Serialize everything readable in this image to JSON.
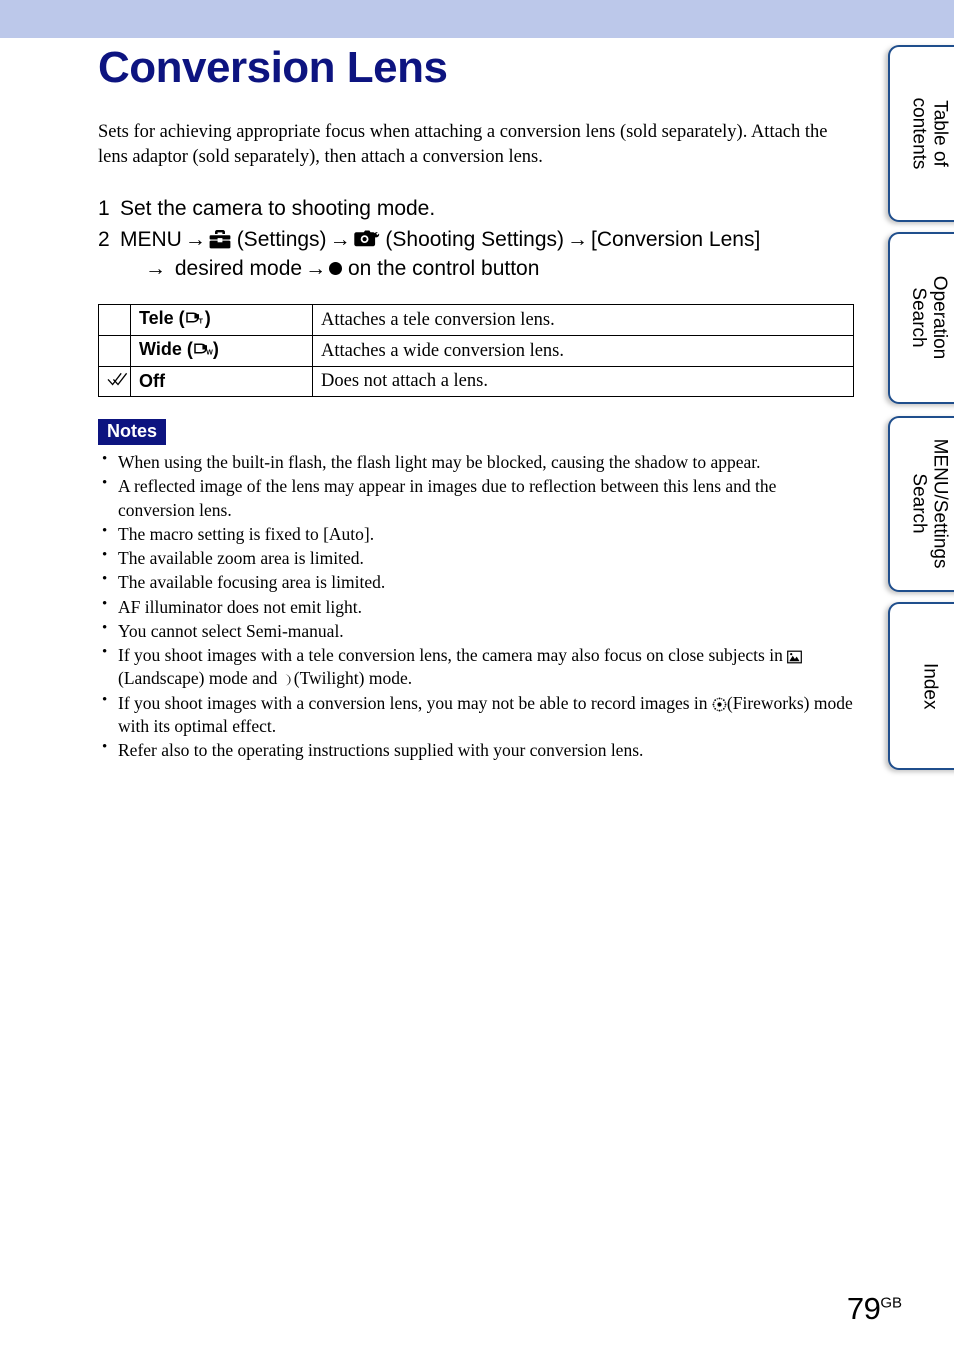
{
  "page": {
    "title": "Conversion Lens",
    "intro": "Sets for achieving appropriate focus when attaching a conversion lens (sold separately). Attach the lens adaptor (sold separately), then attach a conversion lens.",
    "number": "79",
    "number_suffix": "GB",
    "title_color": "#0d1480",
    "topbar_color": "#bcc8ea"
  },
  "tabs": [
    {
      "label": "Table of\ncontents",
      "name": "table-of-contents"
    },
    {
      "label": "Operation\nSearch",
      "name": "operation-search"
    },
    {
      "label": "MENU/Settings\nSearch",
      "name": "menu-settings-search"
    },
    {
      "label": "Index",
      "name": "index"
    }
  ],
  "steps": [
    {
      "number": "1",
      "text": "Set the camera to shooting mode."
    },
    {
      "number": "2",
      "parts": {
        "menu": "MENU",
        "arrow": "→",
        "settings_label": "(Settings)",
        "settings_icon": "toolbox-icon",
        "shooting_label": "(Shooting Settings)",
        "shooting_icon": "camera-wrench-icon",
        "item": "[Conversion Lens]",
        "desired": "desired mode",
        "control": "on the control button",
        "control_icon": "center-button-icon"
      }
    }
  ],
  "table": {
    "rows": [
      {
        "checked": false,
        "check_icon": "",
        "name": "Tele (",
        "name_suffix": ")",
        "icon": "lens-tele-icon",
        "icon_sub": "T",
        "desc": "Attaches a tele conversion lens."
      },
      {
        "checked": false,
        "check_icon": "",
        "name": "Wide (",
        "name_suffix": ")",
        "icon": "lens-wide-icon",
        "icon_sub": "W",
        "desc": "Attaches a wide conversion lens."
      },
      {
        "checked": true,
        "check_icon": "double-check-icon",
        "name": "Off",
        "name_suffix": "",
        "icon": "",
        "icon_sub": "",
        "desc": "Does not attach a lens."
      }
    ]
  },
  "notes": {
    "heading": "Notes",
    "items": [
      {
        "text": "When using the built-in flash, the flash light may be blocked, causing the shadow to appear."
      },
      {
        "text": "A reflected image of the lens may appear in images due to reflection between this lens and the conversion lens."
      },
      {
        "text": "The macro setting is fixed to [Auto]."
      },
      {
        "text": "The available zoom area is limited."
      },
      {
        "text": "The available focusing area is limited."
      },
      {
        "text": "AF illuminator does not emit light."
      },
      {
        "text": "You cannot select Semi-manual."
      },
      {
        "pre": "If you shoot images with a tele conversion lens, the camera may also focus on close subjects in",
        "mid": "(Landscape) mode and",
        "post": "(Twilight) mode.",
        "icon_a": "mountain-icon",
        "icon_b": "moon-icon"
      },
      {
        "pre": "If you shoot images with a conversion lens, you may not be able to record images in",
        "post": "(Fireworks) mode with its optimal effect.",
        "icon_a": "fireworks-icon"
      },
      {
        "text": "Refer also to the operating instructions supplied with your conversion lens."
      }
    ]
  }
}
